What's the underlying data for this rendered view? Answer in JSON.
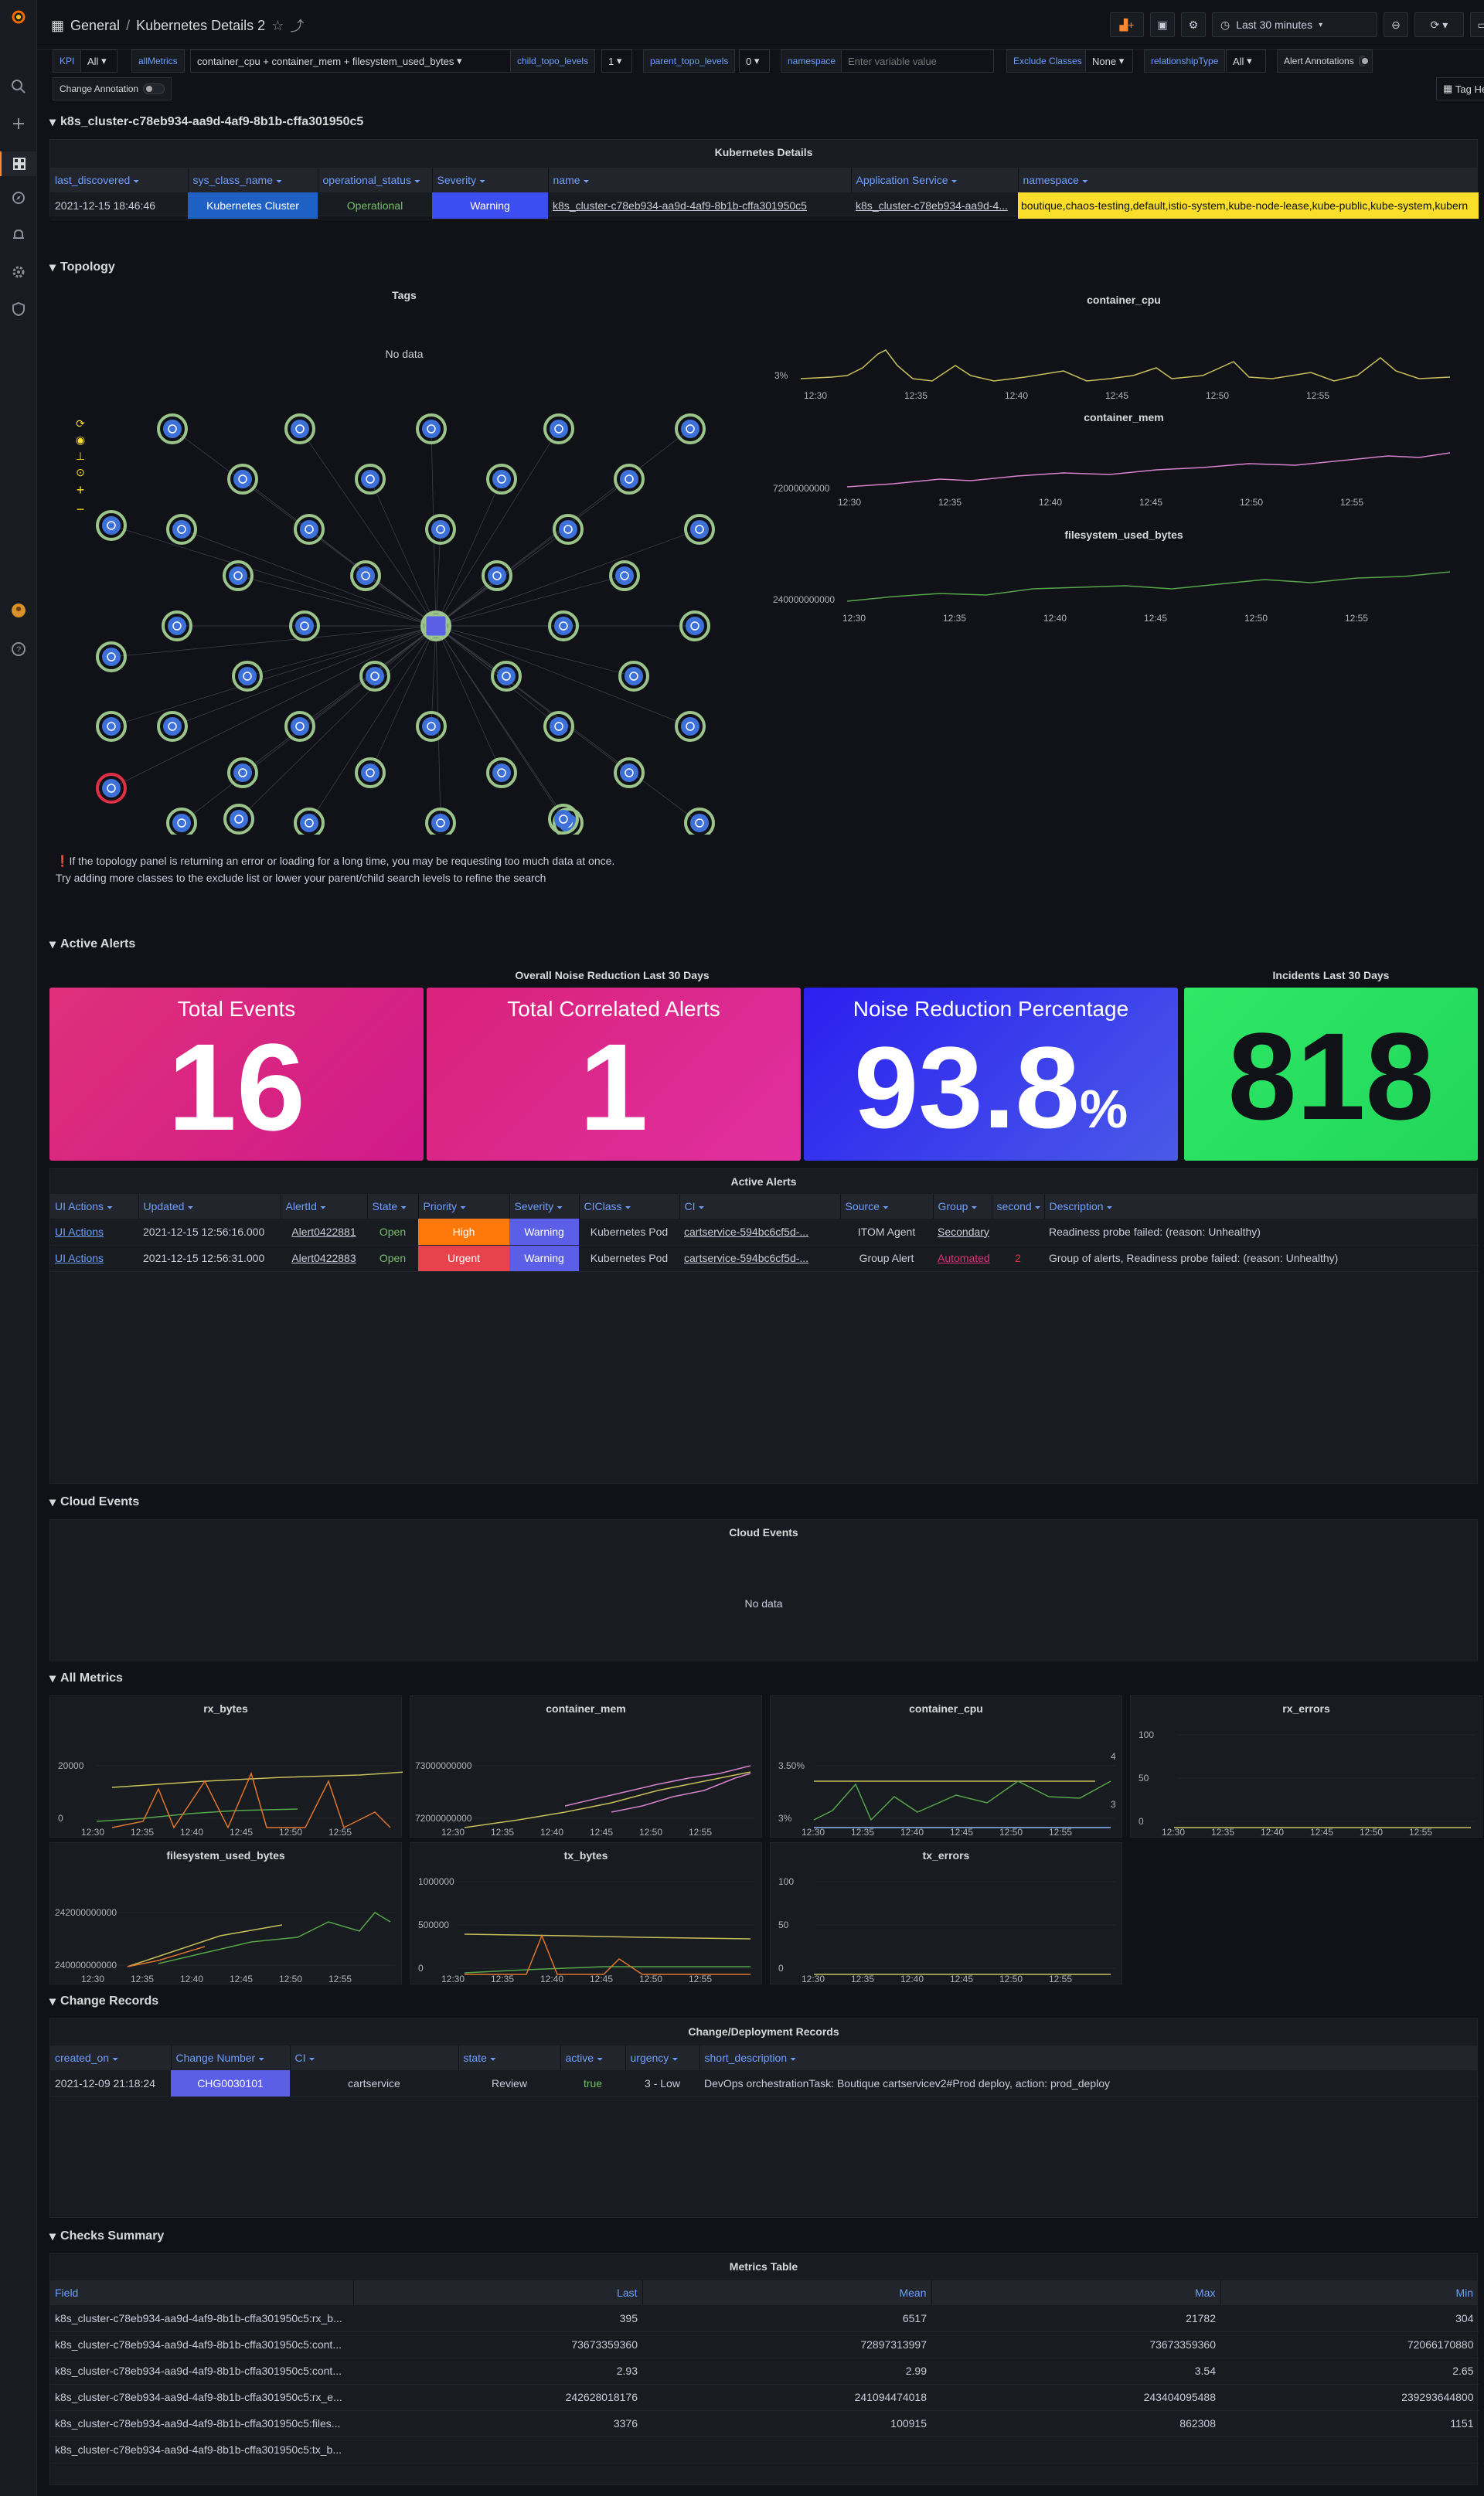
{
  "header": {
    "home": "General",
    "sep": "/",
    "title": "Kubernetes Details 2",
    "time_range": "Last 30 minutes"
  },
  "vars": {
    "kpi_label": "KPI",
    "kpi_value": "All",
    "allmetrics_label": "allMetrics",
    "allmetrics_value": "container_cpu + container_mem + filesystem_used_bytes",
    "child_label": "child_topo_levels",
    "child_value": "1",
    "parent_label": "parent_topo_levels",
    "parent_value": "0",
    "namespace_label": "namespace",
    "namespace_placeholder": "Enter variable value",
    "exclude_label": "Exclude Classes",
    "exclude_value": "None",
    "reltype_label": "relationshipType",
    "reltype_value": "All",
    "alert_ann_label": "Alert Annotations",
    "change_ann_label": "Change Annotation",
    "tag_health": "Tag Health"
  },
  "rows": {
    "cluster": "k8s_cluster-c78eb934-aa9d-4af9-8b1b-cffa301950c5",
    "topology": "Topology",
    "alerts": "Active Alerts",
    "cloud": "Cloud Events",
    "metrics": "All Metrics",
    "changes": "Change Records",
    "checks": "Checks Summary"
  },
  "k8s": {
    "title": "Kubernetes Details",
    "cols": [
      "last_discovered",
      "sys_class_name",
      "operational_status",
      "Severity",
      "name",
      "Application Service",
      "namespace"
    ],
    "row": {
      "last_discovered": "2021-12-15 18:46:46",
      "sys_class_name": "Kubernetes Cluster",
      "operational_status": "Operational",
      "severity": "Warning",
      "name": "k8s_cluster-c78eb934-aa9d-4af9-8b1b-cffa301950c5",
      "app_service": "k8s_cluster-c78eb934-aa9d-4...",
      "namespace": "boutique,chaos-testing,default,istio-system,kube-node-lease,kube-public,kube-system,kubern"
    }
  },
  "topology": {
    "tags_title": "Tags",
    "no_data": "No data",
    "warning_line1": "If the topology panel is returning an error or loading for a long time, you may be requesting too much data at once.",
    "warning_line2": "Try adding more classes to the exclude list or lower your parent/child search levels to refine the search"
  },
  "mini_charts": {
    "cpu": {
      "title": "container_cpu",
      "ylabel": "3%"
    },
    "mem": {
      "title": "container_mem",
      "ylabel": "72000000000"
    },
    "fs": {
      "title": "filesystem_used_bytes",
      "ylabel": "240000000000"
    },
    "times": [
      "12:30",
      "12:35",
      "12:40",
      "12:45",
      "12:50",
      "12:55"
    ]
  },
  "noise": {
    "group_title": "Overall Noise Reduction Last 30 Days",
    "incidents_title": "Incidents Last 30 Days",
    "total_events_label": "Total Events",
    "total_events": "16",
    "correlated_label": "Total Correlated Alerts",
    "correlated": "1",
    "noise_label": "Noise Reduction Percentage",
    "noise_value": "93.8",
    "noise_unit": "%",
    "incidents": "818",
    "colors": {
      "events": "#e02f7a",
      "correlated": "#d9227a",
      "noise": "#3b3bf0",
      "incidents": "#2ee866"
    }
  },
  "alerts": {
    "title": "Active Alerts",
    "cols": [
      "UI Actions",
      "Updated",
      "AlertId",
      "State",
      "Priority",
      "Severity",
      "CIClass",
      "CI",
      "Source",
      "Group",
      "second",
      "Description"
    ],
    "rows": [
      {
        "ui": "UI Actions",
        "updated": "2021-12-15 12:56:16.000",
        "id": "Alert0422881",
        "state": "Open",
        "priority": "High",
        "severity": "Warning",
        "ciclass": "Kubernetes Pod",
        "ci": "cartservice-594bc6cf5d-...",
        "source": "ITOM Agent",
        "group": "Secondary",
        "second": "",
        "desc": "Readiness probe failed: (reason: Unhealthy)"
      },
      {
        "ui": "UI Actions",
        "updated": "2021-12-15 12:56:31.000",
        "id": "Alert0422883",
        "state": "Open",
        "priority": "Urgent",
        "severity": "Warning",
        "ciclass": "Kubernetes Pod",
        "ci": "cartservice-594bc6cf5d-...",
        "source": "Group Alert",
        "group": "Automated",
        "second": "2",
        "desc": "Group of alerts, Readiness probe failed: (reason: Unhealthy)"
      }
    ]
  },
  "cloud": {
    "title": "Cloud Events",
    "no_data": "No data"
  },
  "metrics": {
    "times": [
      "12:30",
      "12:35",
      "12:40",
      "12:45",
      "12:50",
      "12:55"
    ],
    "rx_bytes": {
      "title": "rx_bytes",
      "yticks": [
        "20000",
        "0"
      ]
    },
    "container_mem": {
      "title": "container_mem",
      "yticks": [
        "73000000000",
        "72000000000"
      ]
    },
    "container_cpu": {
      "title": "container_cpu",
      "yticks": [
        "3.50%",
        "3%"
      ],
      "y2ticks": [
        "4",
        "3"
      ]
    },
    "rx_errors": {
      "title": "rx_errors",
      "yticks": [
        "100",
        "50",
        "0"
      ]
    },
    "filesystem_used_bytes": {
      "title": "filesystem_used_bytes",
      "yticks": [
        "242000000000",
        "240000000000"
      ]
    },
    "tx_bytes": {
      "title": "tx_bytes",
      "yticks": [
        "1000000",
        "500000",
        "0"
      ]
    },
    "tx_errors": {
      "title": "tx_errors",
      "yticks": [
        "100",
        "50",
        "0"
      ]
    }
  },
  "changes": {
    "title": "Change/Deployment Records",
    "cols": [
      "created_on",
      "Change Number",
      "CI",
      "state",
      "active",
      "urgency",
      "short_description"
    ],
    "row": {
      "created_on": "2021-12-09 21:18:24",
      "number": "CHG0030101",
      "ci": "cartservice",
      "state": "Review",
      "active": "true",
      "urgency": "3 - Low",
      "desc": "DevOps orchestrationTask: Boutique cartservicev2#Prod deploy, action: prod_deploy"
    }
  },
  "checks": {
    "title": "Metrics Table",
    "cols": [
      "Field",
      "Last",
      "Mean",
      "Max",
      "Min"
    ],
    "rows": [
      [
        "k8s_cluster-c78eb934-aa9d-4af9-8b1b-cffa301950c5:rx_b...",
        "395",
        "6517",
        "21782",
        "304"
      ],
      [
        "k8s_cluster-c78eb934-aa9d-4af9-8b1b-cffa301950c5:cont...",
        "73673359360",
        "72897313997",
        "73673359360",
        "72066170880"
      ],
      [
        "k8s_cluster-c78eb934-aa9d-4af9-8b1b-cffa301950c5:cont...",
        "2.93",
        "2.99",
        "3.54",
        "2.65"
      ],
      [
        "k8s_cluster-c78eb934-aa9d-4af9-8b1b-cffa301950c5:rx_e...",
        "242628018176",
        "241094474018",
        "243404095488",
        "239293644800"
      ],
      [
        "k8s_cluster-c78eb934-aa9d-4af9-8b1b-cffa301950c5:files...",
        "3376",
        "100915",
        "862308",
        "1151"
      ],
      [
        "k8s_cluster-c78eb934-aa9d-4af9-8b1b-cffa301950c5:tx_b...",
        "",
        "",
        "",
        ""
      ]
    ]
  }
}
